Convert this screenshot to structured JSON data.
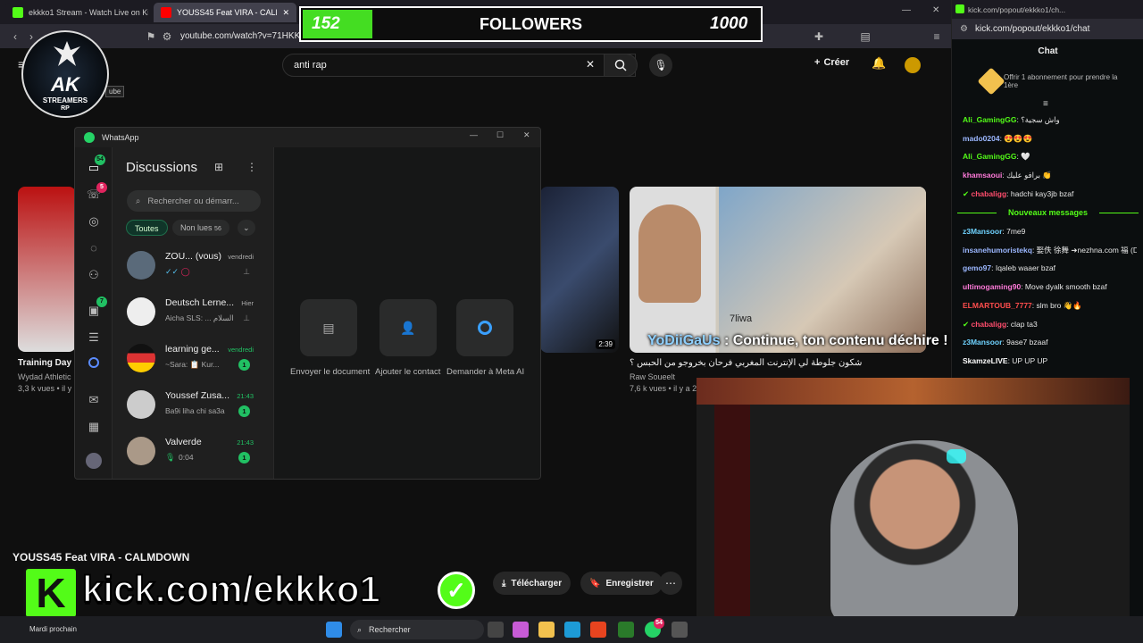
{
  "browser": {
    "tabs": [
      {
        "title": "ekkko1 Stream - Watch Live on Kick",
        "color": "#53fc18"
      },
      {
        "title": "YOUSS45 Feat VIRA - CALMDOW",
        "color": "#ff0000",
        "close": "✕"
      }
    ],
    "url": "youtube.com/watch?v=71HKK"
  },
  "followers_overlay": {
    "current": "152",
    "label": "FOLLOWERS",
    "goal": "1000",
    "progress": 0.152
  },
  "logo": {
    "line1": "AK",
    "line2": "STREAMERS",
    "line3": "RP"
  },
  "youtube": {
    "tooltip": "ube",
    "search_value": "anti rap",
    "create_label": "Créer",
    "videos": [
      {
        "title": "Training Day",
        "channel": "Wydad Athletic",
        "meta": "3,3 k vues • il y"
      },
      {
        "title": "شكون جلوطة لي الإنترنت المغربي فرحان بخروجو من الحبس ؟",
        "channel": "Raw Soueelt",
        "meta": "7,6 k vues • il y a 2",
        "duration": "2:39"
      }
    ],
    "thumb_caption": "7liwa",
    "now_playing_title": "YOUSS45 Feat VIRA - CALMDOWN",
    "download_label": "Télécharger",
    "save_label": "Enregistrer"
  },
  "whatsapp": {
    "window_title": "WhatsApp",
    "heading": "Discussions",
    "search_placeholder": "Rechercher ou démarr...",
    "filters": [
      {
        "label": "Toutes"
      },
      {
        "label": "Non lues",
        "count": "56"
      }
    ],
    "rail_badges": {
      "chats": "54",
      "calls": "5",
      "channels": "7"
    },
    "chats": [
      {
        "name": "ZOU... (vous)",
        "time": "vendredi",
        "preview": "",
        "unread": "",
        "avatar": "#5a6a7a"
      },
      {
        "name": "Deutsch Lerne...",
        "time": "Hier",
        "preview": "Aicha SLS: ... السلام",
        "unread": "",
        "avatar": "#e8e8e8"
      },
      {
        "name": "learning ge...",
        "time": "vendredi",
        "preview": "~Sara: 📋 Kur...",
        "unread": "1",
        "avatar": "#d33"
      },
      {
        "name": "Youssef Zusa...",
        "time": "21:43",
        "preview": "Ba9i liha chi sa3a",
        "unread": "1",
        "avatar": "#ccc"
      },
      {
        "name": "Valverde",
        "time": "21:43",
        "preview": "0:04",
        "unread": "1",
        "avatar": "#a98"
      }
    ],
    "actions": [
      {
        "label": "Envoyer le document"
      },
      {
        "label": "Ajouter le contact"
      },
      {
        "label": "Demander à Meta AI"
      }
    ]
  },
  "kick": {
    "top_url": "kick.com/popout/ekkko1/ch...",
    "url": "kick.com/popout/ekkko1/chat",
    "header": "Chat",
    "sub_offer": "Offrir 1 abonnement pour prendre la 1ère",
    "new_messages_label": "Nouveaux messages",
    "messages_before": [
      {
        "user": "Ali_GamingGG",
        "text": "واش سجية؟",
        "color": "#53fc18"
      },
      {
        "user": "mado0204",
        "text": "😍😍😍",
        "color": "#9bb7ff"
      },
      {
        "user": "Ali_GamingGG",
        "text": "🤍",
        "color": "#53fc18"
      },
      {
        "user": "khamsaoui",
        "text": "برافو عليك 👏",
        "color": "#ff7ad9"
      },
      {
        "user": "chabaligg",
        "text": "hadchi kay3jb bzaf",
        "color": "#ff4d6d",
        "verified": true
      }
    ],
    "messages_after": [
      {
        "user": "z3Mansoor",
        "text": "7me9",
        "color": "#6fd3ff"
      },
      {
        "user": "insanehumoristekq",
        "text": "娶佚 徐舞 ➜nezhna.com 福 (Deleted)",
        "color": "#9bb7ff"
      },
      {
        "user": "gemo97",
        "text": "Iqaleb waaer bzaf",
        "color": "#9bb7ff"
      },
      {
        "user": "ultimogaming90",
        "text": "Move dyalk smooth bzaf",
        "color": "#ff7ad9"
      },
      {
        "user": "ELMARTOUB_7777",
        "text": "slm bro 👋🔥",
        "color": "#ff4d4d"
      },
      {
        "user": "chabaligg",
        "text": "clap ta3",
        "color": "#ff4d6d",
        "verified": true
      },
      {
        "user": "z3Mansoor",
        "text": "9ase7 bzaaf",
        "color": "#6fd3ff"
      },
      {
        "user": "SkamzeLIVE",
        "text": "UP UP UP",
        "color": "#ffffff"
      }
    ]
  },
  "overlay_alert": {
    "user": "YoDiiGaUs",
    "text": " : Continue, ton contenu déchire !"
  },
  "kick_banner": {
    "text": "kick.com/ekkko1"
  },
  "taskbar": {
    "search_label": "Rechercher",
    "weather_line": "Mardi prochain",
    "wa_badge": "54"
  }
}
